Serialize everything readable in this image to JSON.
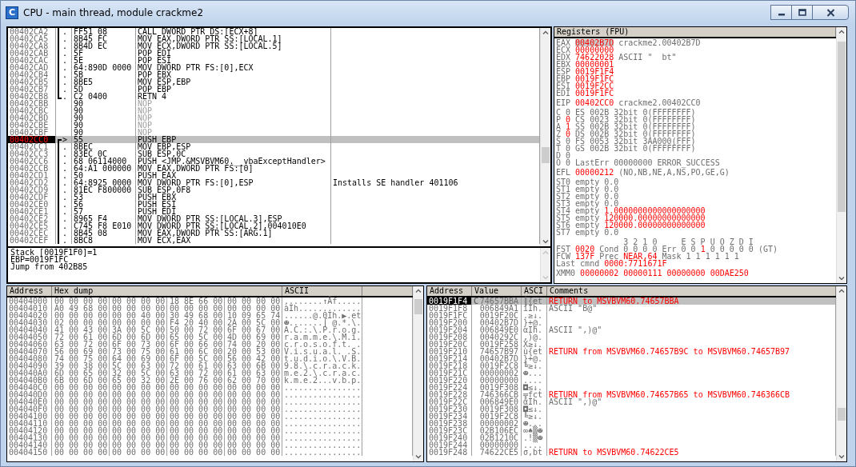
{
  "window": {
    "title": "CPU - main thread, module crackme2",
    "icon_letter": "C"
  },
  "disassembly": {
    "rows": [
      {
        "address": "00402CA2",
        "mark": ".",
        "in_loop": true,
        "loop_start": false,
        "loop_end": false,
        "hex": "FF51 08",
        "instruction": "CALL DWORD PTR DS:[ECX+8]",
        "kind": "code",
        "selected": false
      },
      {
        "address": "00402CA5",
        "mark": ".",
        "in_loop": true,
        "loop_start": false,
        "loop_end": false,
        "hex": "8B45 FC",
        "instruction": "MOV EAX,DWORD PTR SS:[LOCAL.1]",
        "kind": "code",
        "selected": false
      },
      {
        "address": "00402CA8",
        "mark": ".",
        "in_loop": true,
        "loop_start": false,
        "loop_end": false,
        "hex": "8B4D EC",
        "instruction": "MOV ECX,DWORD PTR SS:[LOCAL.5]",
        "kind": "code",
        "selected": false
      },
      {
        "address": "00402CAB",
        "mark": ".",
        "in_loop": true,
        "loop_start": false,
        "loop_end": false,
        "hex": "5F",
        "instruction": "POP EDI",
        "kind": "code",
        "selected": false
      },
      {
        "address": "00402CAC",
        "mark": ".",
        "in_loop": true,
        "loop_start": false,
        "loop_end": false,
        "hex": "5E",
        "instruction": "POP ESI",
        "kind": "code",
        "selected": false
      },
      {
        "address": "00402CAD",
        "mark": ".",
        "in_loop": true,
        "loop_start": false,
        "loop_end": false,
        "hex": "64:890D 0000",
        "instruction": "MOV DWORD PTR FS:[0],ECX",
        "kind": "code",
        "selected": false
      },
      {
        "address": "00402CB4",
        "mark": ".",
        "in_loop": true,
        "loop_start": false,
        "loop_end": false,
        "hex": "5B",
        "instruction": "POP EBX",
        "kind": "code",
        "selected": false
      },
      {
        "address": "00402CB5",
        "mark": ".",
        "in_loop": true,
        "loop_start": false,
        "loop_end": false,
        "hex": "8BE5",
        "instruction": "MOV ESP,EBP",
        "kind": "code",
        "selected": false
      },
      {
        "address": "00402CB7",
        "mark": ".",
        "in_loop": true,
        "loop_start": false,
        "loop_end": false,
        "hex": "5D",
        "instruction": "POP EBP",
        "kind": "code",
        "selected": false
      },
      {
        "address": "00402CB8",
        "mark": ".",
        "in_loop": true,
        "loop_start": false,
        "loop_end": true,
        "hex": "C2 0400",
        "instruction": "RETN 4",
        "kind": "code",
        "selected": false
      },
      {
        "address": "00402CBB",
        "in_loop": false,
        "loop_start": false,
        "loop_end": false,
        "hex": "90",
        "instruction": "NOP",
        "kind": "nop",
        "selected": false
      },
      {
        "address": "00402CBC",
        "in_loop": false,
        "loop_start": false,
        "loop_end": false,
        "hex": "90",
        "instruction": "NOP",
        "kind": "nop",
        "selected": false
      },
      {
        "address": "00402CBD",
        "in_loop": false,
        "loop_start": false,
        "loop_end": false,
        "hex": "90",
        "instruction": "NOP",
        "kind": "nop",
        "selected": false
      },
      {
        "address": "00402CBE",
        "in_loop": false,
        "loop_start": false,
        "loop_end": false,
        "hex": "90",
        "instruction": "NOP",
        "kind": "nop",
        "selected": false
      },
      {
        "address": "00402CBF",
        "in_loop": false,
        "loop_start": false,
        "loop_end": false,
        "hex": "90",
        "instruction": "NOP",
        "kind": "nop",
        "selected": false
      },
      {
        "address": "00402CC0",
        "mark": ">",
        "in_loop": true,
        "loop_start": true,
        "loop_end": false,
        "hex": "55",
        "instruction": "PUSH EBP",
        "kind": "code",
        "selected": true
      },
      {
        "address": "00402CC1",
        "mark": ".",
        "in_loop": true,
        "loop_start": false,
        "loop_end": false,
        "hex": "8BEC",
        "instruction": "MOV EBP,ESP",
        "kind": "code",
        "selected": false
      },
      {
        "address": "00402CC3",
        "mark": ".",
        "in_loop": true,
        "loop_start": false,
        "loop_end": false,
        "hex": "83EC 0C",
        "instruction": "SUB ESP,0C",
        "kind": "code",
        "selected": false
      },
      {
        "address": "00402CC6",
        "mark": ".",
        "in_loop": true,
        "loop_start": false,
        "loop_end": false,
        "hex": "68 06114000",
        "instruction": "PUSH <JMP.&MSVBVM60.__vbaExceptHandler>",
        "kind": "code",
        "selected": false
      },
      {
        "address": "00402CCB",
        "mark": ".",
        "in_loop": true,
        "loop_start": false,
        "loop_end": false,
        "hex": "64:A1 000000",
        "instruction": "MOV EAX,DWORD PTR FS:[0]",
        "kind": "code",
        "selected": false
      },
      {
        "address": "00402CD1",
        "mark": ".",
        "in_loop": true,
        "loop_start": false,
        "loop_end": false,
        "hex": "50",
        "instruction": "PUSH EAX",
        "kind": "code",
        "selected": false
      },
      {
        "address": "00402CD2",
        "mark": ".",
        "in_loop": true,
        "loop_start": false,
        "loop_end": false,
        "hex": "64:8925 0000",
        "instruction": "MOV DWORD PTR FS:[0],ESP",
        "comment": "Installs SE handler 401106",
        "kind": "code",
        "selected": false
      },
      {
        "address": "00402CD9",
        "mark": ".",
        "in_loop": true,
        "loop_start": false,
        "loop_end": false,
        "hex": "81EC F800000",
        "instruction": "SUB ESP,0F8",
        "kind": "code",
        "selected": false
      },
      {
        "address": "00402CDF",
        "mark": ".",
        "in_loop": true,
        "loop_start": false,
        "loop_end": false,
        "hex": "53",
        "instruction": "PUSH EBX",
        "kind": "code",
        "selected": false
      },
      {
        "address": "00402CE0",
        "mark": ".",
        "in_loop": true,
        "loop_start": false,
        "loop_end": false,
        "hex": "56",
        "instruction": "PUSH ESI",
        "kind": "code",
        "selected": false
      },
      {
        "address": "00402CE1",
        "mark": ".",
        "in_loop": true,
        "loop_start": false,
        "loop_end": false,
        "hex": "57",
        "instruction": "PUSH EDI",
        "kind": "code",
        "selected": false
      },
      {
        "address": "00402CE2",
        "mark": ".",
        "in_loop": true,
        "loop_start": false,
        "loop_end": false,
        "hex": "8965 F4",
        "instruction": "MOV DWORD PTR SS:[LOCAL.3],ESP",
        "kind": "code",
        "selected": false
      },
      {
        "address": "00402CE5",
        "mark": ".",
        "in_loop": true,
        "loop_start": false,
        "loop_end": false,
        "hex": "C745 F8 E010",
        "instruction": "MOV DWORD PTR SS:[LOCAL.2],004010E0",
        "kind": "code",
        "selected": false
      },
      {
        "address": "00402CEC",
        "mark": ".",
        "in_loop": true,
        "loop_start": false,
        "loop_end": false,
        "hex": "8B45 08",
        "instruction": "MOV EAX,DWORD PTR SS:[ARG.1]",
        "kind": "code",
        "selected": false
      },
      {
        "address": "00402CEF",
        "mark": ".",
        "in_loop": true,
        "loop_start": false,
        "loop_end": false,
        "hex": "8BC8",
        "instruction": "MOV ECX,EAX",
        "kind": "code",
        "selected": false
      }
    ],
    "info": [
      "Stack [0019F1F0]=1",
      "EBP=0019F1FC",
      "Jump from 402B85"
    ]
  },
  "registers": {
    "title": "Registers (FPU)",
    "groups": [
      [
        [
          {
            "text": "EAX",
            "changed": false
          },
          {
            "text": "00402B7D",
            "changed": true,
            "selected": true
          },
          {
            "text": "crackme2.00402B7D",
            "changed": false
          }
        ],
        [
          {
            "text": "ECX",
            "changed": false
          },
          {
            "text": "00000000",
            "changed": true,
            "selected": false
          }
        ],
        [
          {
            "text": "EDX",
            "changed": false
          },
          {
            "text": "74622028",
            "changed": true,
            "selected": false
          },
          {
            "text": "ASCII \"  bt\"",
            "changed": false
          }
        ],
        [
          {
            "text": "EBX",
            "changed": false
          },
          {
            "text": "00000001",
            "changed": true,
            "selected": false
          }
        ],
        [
          {
            "text": "ESP",
            "changed": false
          },
          {
            "text": "0019F1F4",
            "changed": true,
            "selected": false
          }
        ],
        [
          {
            "text": "EBP",
            "changed": false
          },
          {
            "text": "0019F1FC",
            "changed": true,
            "selected": false
          }
        ],
        [
          {
            "text": "ESI",
            "changed": false
          },
          {
            "text": "0019F2CC",
            "changed": true,
            "selected": false
          }
        ],
        [
          {
            "text": "EDI",
            "changed": false
          },
          {
            "text": "0019F1FC",
            "changed": true,
            "selected": false
          }
        ]
      ],
      [
        [
          {
            "text": "EIP",
            "changed": false
          },
          {
            "text": "00402CC0",
            "changed": true,
            "selected": false
          },
          {
            "text": "crackme2.00402CC0",
            "changed": false
          }
        ]
      ],
      [
        [
          {
            "text": "C",
            "changed": false
          },
          {
            "text": "0",
            "changed": false
          },
          {
            "text": "ES 002B 32bit 0(FFFFFFFF)",
            "changed": false
          }
        ],
        [
          {
            "text": "P",
            "changed": false
          },
          {
            "text": "0",
            "changed": true
          },
          {
            "text": "CS 0023 32bit 0(FFFFFFFF)",
            "changed": false
          }
        ],
        [
          {
            "text": "A",
            "changed": false
          },
          {
            "text": "1",
            "changed": true
          },
          {
            "text": "SS 002B 32bit 0(FFFFFFFF)",
            "changed": false
          }
        ],
        [
          {
            "text": "Z",
            "changed": false
          },
          {
            "text": "0",
            "changed": true
          },
          {
            "text": "DS 002B 32bit 0(FFFFFFFF)",
            "changed": false
          }
        ],
        [
          {
            "text": "S",
            "changed": false
          },
          {
            "text": "0",
            "changed": false
          },
          {
            "text": "FS 0053 32bit 3AA000(FFF)",
            "changed": false
          }
        ],
        [
          {
            "text": "T",
            "changed": false
          },
          {
            "text": "0",
            "changed": false
          },
          {
            "text": "GS 002B 32bit 0(FFFFFFFF)",
            "changed": false
          }
        ],
        [
          {
            "text": "D",
            "changed": false
          },
          {
            "text": "0",
            "changed": false
          }
        ],
        [
          {
            "text": "O",
            "changed": false
          },
          {
            "text": "0",
            "changed": false
          },
          {
            "text": "LastErr 00000000 ERROR_SUCCESS",
            "changed": false
          }
        ]
      ],
      [
        [
          {
            "text": "EFL",
            "changed": false
          },
          {
            "text": "00000212",
            "changed": true
          },
          {
            "text": "(NO,NB,NE,A,NS,PO,GE,G)",
            "changed": false
          }
        ]
      ],
      [
        [
          {
            "text": "ST0 empty",
            "changed": false
          },
          {
            "text": "0.0",
            "changed": false
          }
        ],
        [
          {
            "text": "ST1 empty",
            "changed": false
          },
          {
            "text": "0.0",
            "changed": false
          }
        ],
        [
          {
            "text": "ST2 empty",
            "changed": false
          },
          {
            "text": "0.0",
            "changed": false
          }
        ],
        [
          {
            "text": "ST3 empty",
            "changed": false
          },
          {
            "text": "0.0",
            "changed": false
          }
        ],
        [
          {
            "text": "ST4 empty",
            "changed": false
          },
          {
            "text": "1.0000000000000000000",
            "changed": true
          }
        ],
        [
          {
            "text": "ST5 empty",
            "changed": false
          },
          {
            "text": "120000.00000000000000",
            "changed": true
          }
        ],
        [
          {
            "text": "ST6 empty",
            "changed": false
          },
          {
            "text": "120000.00000000000000",
            "changed": true
          }
        ],
        [
          {
            "text": "ST7 empty",
            "changed": false
          },
          {
            "text": "0.0",
            "changed": false
          }
        ]
      ]
    ],
    "fpu_status": {
      "bits": "3 2 1 0",
      "flags": "E S P U O Z D I",
      "lines": [
        [
          {
            "text": "FST",
            "changed": false
          },
          {
            "text": "0020",
            "changed": true
          },
          {
            "text": "Cond 0 0 0 0",
            "changed": false
          },
          {
            "text": "Err 0 0",
            "changed": false
          },
          {
            "text": "1",
            "changed": true
          },
          {
            "text": "0 0 0 0 0",
            "changed": false
          },
          {
            "text": "(GT)",
            "changed": false
          }
        ],
        [
          {
            "text": "FCW",
            "changed": false
          },
          {
            "text": "137F",
            "changed": true
          },
          {
            "text": "Prec",
            "changed": false
          },
          {
            "text": "NEAR,64",
            "changed": true
          },
          {
            "text": "Mask",
            "changed": false
          },
          {
            "text": "1 1 1 1 1 1",
            "changed": false
          }
        ],
        [
          {
            "text": "Last cmnd",
            "changed": false
          },
          {
            "text": "0000:7711671F",
            "changed": true
          }
        ]
      ]
    },
    "xmm": [
      [
        {
          "text": "XMM0",
          "changed": false
        },
        {
          "text": "00000002 00000111 00000000 00DAE250",
          "changed": true
        }
      ]
    ]
  },
  "dump": {
    "columns": [
      "Address",
      "Hex dump",
      "ASCII"
    ],
    "rows": [
      {
        "address": "00404000",
        "hex": [
          "00 00 00 00",
          "00 00 00 00",
          "18 8E 66 00",
          "00 00 00 00"
        ],
        "ascii": "........↑Äf....."
      },
      {
        "address": "00404010",
        "hex": [
          "A0 49 68 00",
          "00 00 00 00",
          "00 00 00 00",
          "00 00 00 00"
        ],
        "ascii": "àIh............."
      },
      {
        "address": "00404020",
        "hex": [
          "00 00 00 00",
          "00 00 40 00",
          "30 49 68 00",
          "10 09 65 74"
        ],
        "ascii": "......@.0Ih.▶.et"
      },
      {
        "address": "00404030",
        "hex": [
          "02 00 00 00",
          "00 00 00 00",
          "F4 20 40 00",
          "2A 00 5C 00"
        ],
        "ascii": "☻.......⌠ @.*.\\."
      },
      {
        "address": "00404040",
        "hex": [
          "41 00 43 00",
          "3A 00 5C 00",
          "50 00 72 00",
          "6F 00 67 00"
        ],
        "ascii": "A.C.:.\\.P.r.o.g."
      },
      {
        "address": "00404050",
        "hex": [
          "72 00 61 00",
          "6D 00 6D 00",
          "65 00 5C 00",
          "4D 00 69 00"
        ],
        "ascii": "r.a.m.m.e.\\.M.i."
      },
      {
        "address": "00404060",
        "hex": [
          "63 00 72 00",
          "6F 00 73 00",
          "6F 00 66 00",
          "74 00 20 00"
        ],
        "ascii": "c.r.o.s.o.f.t. ."
      },
      {
        "address": "00404070",
        "hex": [
          "56 00 69 00",
          "73 00 75 00",
          "61 00 6C 00",
          "20 00 53 00"
        ],
        "ascii": "V.i.s.u.a.l. .S."
      },
      {
        "address": "00404080",
        "hex": [
          "74 00 75 00",
          "64 00 69 00",
          "6F 00 5C 00",
          "56 00 42 00"
        ],
        "ascii": "t.u.d.i.o.\\.V.B."
      },
      {
        "address": "00404090",
        "hex": [
          "39 00 38 00",
          "5C 00 63 00",
          "72 00 61 00",
          "63 00 6B 00"
        ],
        "ascii": "9.8.\\.c.r.a.c.k."
      },
      {
        "address": "004040A0",
        "hex": [
          "6D 00 65 00",
          "32 00 5C 00",
          "63 00 72 00",
          "61 00 63 00"
        ],
        "ascii": "m.e.2.\\.c.r.a.c."
      },
      {
        "address": "004040B0",
        "hex": [
          "6B 00 6D 00",
          "65 00 32 00",
          "2E 00 76 00",
          "62 00 70 00"
        ],
        "ascii": "k.m.e.2...v.b.p."
      },
      {
        "address": "004040C0",
        "hex": [
          "00 00 00 00",
          "00 00 00 00",
          "00 00 00 00",
          "00 00 00 00"
        ],
        "ascii": "................"
      },
      {
        "address": "004040D0",
        "hex": [
          "00 00 00 00",
          "00 00 00 00",
          "00 00 00 00",
          "00 00 00 00"
        ],
        "ascii": "................"
      },
      {
        "address": "004040E0",
        "hex": [
          "00 00 00 00",
          "00 00 00 00",
          "00 00 00 00",
          "00 00 00 00"
        ],
        "ascii": "................"
      },
      {
        "address": "004040F0",
        "hex": [
          "00 00 00 00",
          "00 00 00 00",
          "00 00 00 00",
          "00 00 00 00"
        ],
        "ascii": "................"
      },
      {
        "address": "00404100",
        "hex": [
          "00 00 00 00",
          "00 00 00 00",
          "00 00 00 00",
          "00 00 00 00"
        ],
        "ascii": "................"
      },
      {
        "address": "00404110",
        "hex": [
          "00 00 00 00",
          "00 00 00 00",
          "00 00 00 00",
          "00 00 00 00"
        ],
        "ascii": "................"
      },
      {
        "address": "00404120",
        "hex": [
          "00 00 00 00",
          "00 00 00 00",
          "00 00 00 00",
          "00 00 00 00"
        ],
        "ascii": "................"
      },
      {
        "address": "00404130",
        "hex": [
          "00 00 00 00",
          "00 00 00 00",
          "00 00 00 00",
          "00 00 00 00"
        ],
        "ascii": "................"
      },
      {
        "address": "00404140",
        "hex": [
          "00 00 00 00",
          "00 00 00 00",
          "00 00 00 00",
          "00 00 00 00"
        ],
        "ascii": "................"
      },
      {
        "address": "00404150",
        "hex": [
          "00 00 00 00",
          "00 00 00 00",
          "00 00 00 00",
          "00 00 00 00"
        ],
        "ascii": "................"
      }
    ]
  },
  "stack": {
    "columns": [
      "Address",
      "Value",
      "ASCI",
      "Comments"
    ],
    "rows": [
      {
        "address": "0019F1F4",
        "flag": "C",
        "value": "74657BBA",
        "ascii": "║{et",
        "comment": {
          "text": "RETURN to MSVBVM60.74657BBA",
          "kind": "return"
        },
        "selected": true
      },
      {
        "address": "0019F1F8",
        "value": "006849A1",
        "ascii": "íIh.",
        "comment": {
          "text": "ASCII \"B@\"",
          "kind": "ascii"
        },
        "selected": false
      },
      {
        "address": "0019F1FC",
        "value": "0019F20C",
        "ascii": ".≥↓.",
        "selected": false
      },
      {
        "address": "0019F200",
        "value": "00402B7D",
        "ascii": "}+@.",
        "selected": false
      },
      {
        "address": "0019F204",
        "value": "006849E0",
        "ascii": "αIh.",
        "comment": {
          "text": "ASCII \",)@\"",
          "kind": "ascii"
        },
        "selected": false
      },
      {
        "address": "0019F208",
        "value": "0040292C",
        "ascii": ",)@.",
        "selected": false
      },
      {
        "address": "0019F20C",
        "value": "0019F258",
        "ascii": "X≥↓.",
        "selected": false
      },
      {
        "address": "0019F210",
        "value": "74657B97",
        "ascii": "ù{et",
        "comment": {
          "text": "RETURN from MSVBVM60.74657B9C to MSVBVM60.74657B97",
          "kind": "return"
        },
        "selected": false
      },
      {
        "address": "0019F214",
        "value": "00402B7D",
        "ascii": "}+@.",
        "selected": false
      },
      {
        "address": "0019F218",
        "value": "0019F2C8",
        "ascii": "╚≥↓.",
        "selected": false
      },
      {
        "address": "0019F21C",
        "value": "00000002",
        "ascii": "☻...",
        "selected": false
      },
      {
        "address": "0019F220",
        "value": "00000000",
        "ascii": "....",
        "selected": false
      },
      {
        "address": "0019F224",
        "value": "0019F308",
        "ascii": "◘≤↓.",
        "selected": false
      },
      {
        "address": "0019F228",
        "value": "746366CB",
        "ascii": "╦fct",
        "comment": {
          "text": "RETURN from MSVBVM60.74657B65 to MSVBVM60.746366CB",
          "kind": "return"
        },
        "selected": false
      },
      {
        "address": "0019F22C",
        "value": "006849E0",
        "ascii": "αIh.",
        "comment": {
          "text": "ASCII \",)@\"",
          "kind": "ascii"
        },
        "selected": false
      },
      {
        "address": "0019F230",
        "value": "0019F308",
        "ascii": "◘≤↓.",
        "selected": false
      },
      {
        "address": "0019F234",
        "value": "0019F2C8",
        "ascii": "╚≥↓.",
        "selected": false
      },
      {
        "address": "0019F238",
        "value": "00000002",
        "ascii": "☻...",
        "selected": false
      },
      {
        "address": "0019F23C",
        "value": "02B106EC",
        "ascii": "∞♠▒☻",
        "selected": false
      },
      {
        "address": "0019F240",
        "value": "02B1210C",
        "ascii": ".!▒☻",
        "selected": false
      },
      {
        "address": "0019F244",
        "value": "00000000",
        "ascii": "....",
        "selected": false
      },
      {
        "address": "0019F248",
        "value": "74622CE5",
        "ascii": "σ,bt",
        "comment": {
          "text": "RETURN to MSVBVM60.74622CE5",
          "kind": "return"
        },
        "selected": false
      }
    ]
  }
}
